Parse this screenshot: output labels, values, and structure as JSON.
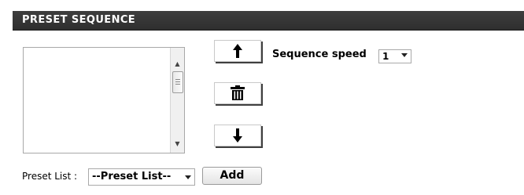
{
  "section": {
    "title": "PRESET SEQUENCE"
  },
  "controls": {
    "up_icon": "arrow-up-icon",
    "delete_icon": "trash-icon",
    "down_icon": "arrow-down-icon"
  },
  "speed": {
    "label": "Sequence speed",
    "value": "1"
  },
  "preset": {
    "label": "Preset List :",
    "selected": "--Preset List--",
    "add_label": "Add"
  },
  "colors": {
    "header_bg": "#333333",
    "header_text": "#ffffff"
  }
}
